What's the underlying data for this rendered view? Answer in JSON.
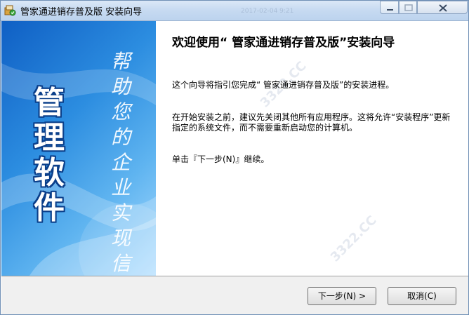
{
  "window": {
    "title": "管家通进销存普及版 安装向导",
    "bg_timestamp": "2017-02-04  9:21"
  },
  "banner": {
    "brand_text": "管理软件",
    "slogan": "帮助您的企业实现信息化"
  },
  "content": {
    "heading": "欢迎使用“ 管家通进销存普及版”安装向导",
    "paragraph1": "这个向导将指引您完成“ 管家通进销存普及版”的安装进程。",
    "paragraph2": "在开始安装之前，建议先关闭其他所有应用程序。这将允许“安装程序”更新指定的系统文件，而不需要重新启动您的计算机。",
    "paragraph3": "单击『下一步(N)』继续。"
  },
  "buttons": {
    "next": "下一步(N) >",
    "cancel": "取消(C)"
  },
  "colors": {
    "banner_dark": "#0f5fc4",
    "banner_light": "#a9dbff",
    "titlebar": "#c6daf1"
  }
}
